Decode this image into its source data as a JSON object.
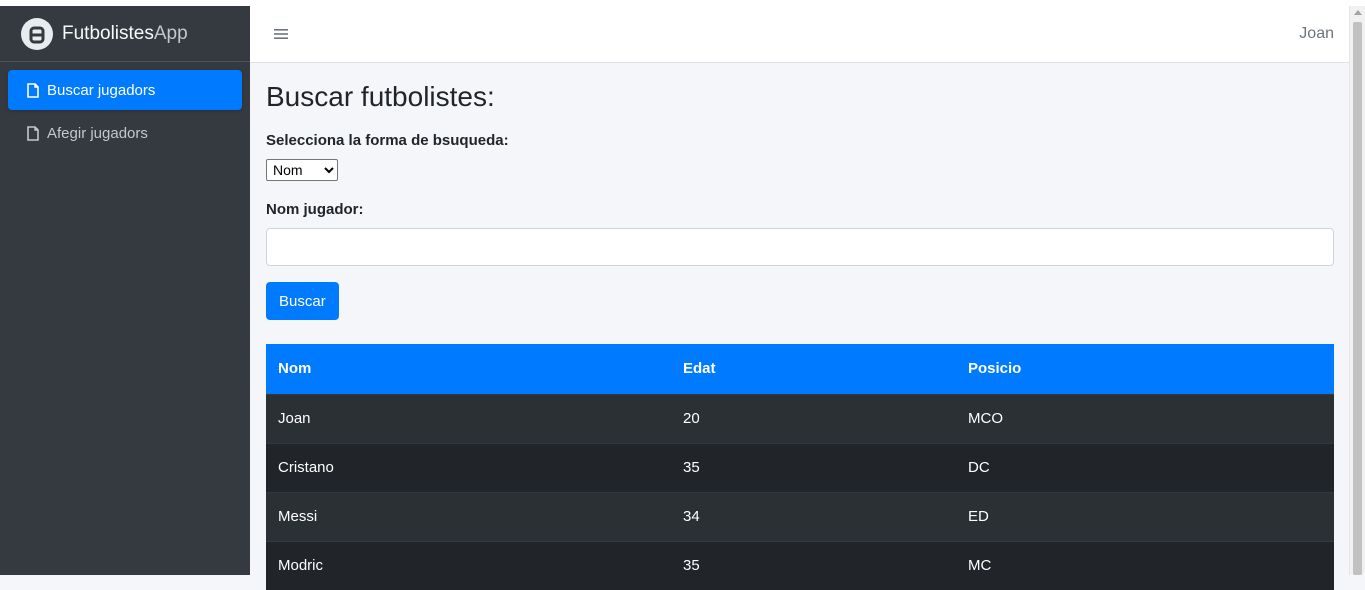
{
  "app": {
    "brand_main": "Futbolistes",
    "brand_suffix": "App"
  },
  "sidebar": {
    "items": [
      {
        "label": "Buscar jugadors",
        "icon": "file-icon",
        "active": true
      },
      {
        "label": "Afegir jugadors",
        "icon": "file-icon",
        "active": false
      }
    ]
  },
  "navbar": {
    "menu_icon": "hamburger-icon",
    "user": "Joan"
  },
  "main": {
    "title": "Buscar futbolistes:",
    "mode_label": "Selecciona la forma de bsuqueda:",
    "mode_selected": "Nom",
    "name_label": "Nom jugador:",
    "name_value": "",
    "search_button": "Buscar"
  },
  "table": {
    "headers": [
      "Nom",
      "Edat",
      "Posicio"
    ],
    "rows": [
      [
        "Joan",
        "20",
        "MCO"
      ],
      [
        "Cristano",
        "35",
        "DC"
      ],
      [
        "Messi",
        "34",
        "ED"
      ],
      [
        "Modric",
        "35",
        "MC"
      ]
    ]
  },
  "colors": {
    "accent": "#007bff",
    "sidebar": "#343a40",
    "table_dark": "#212529"
  }
}
